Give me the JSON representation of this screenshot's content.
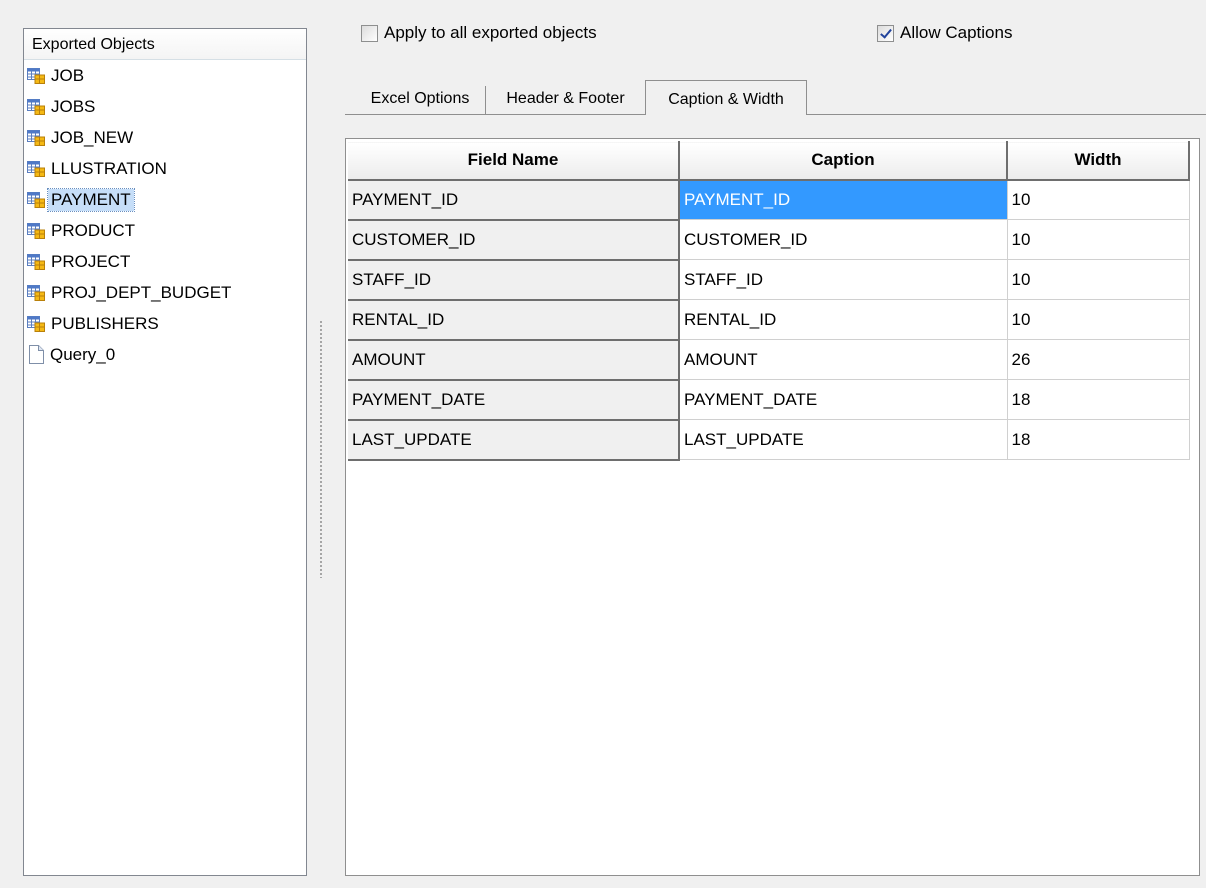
{
  "objects_panel": {
    "header": "Exported Objects",
    "items": [
      {
        "label": "JOB",
        "icon": "table-icon"
      },
      {
        "label": "JOBS",
        "icon": "table-icon"
      },
      {
        "label": "JOB_NEW",
        "icon": "table-icon"
      },
      {
        "label": "LLUSTRATION",
        "icon": "table-icon"
      },
      {
        "label": "PAYMENT",
        "icon": "table-icon",
        "selected": true
      },
      {
        "label": "PRODUCT",
        "icon": "table-icon"
      },
      {
        "label": "PROJECT",
        "icon": "table-icon"
      },
      {
        "label": "PROJ_DEPT_BUDGET",
        "icon": "table-icon"
      },
      {
        "label": "PUBLISHERS",
        "icon": "table-icon"
      },
      {
        "label": "Query_0",
        "icon": "query-icon"
      }
    ]
  },
  "options": {
    "apply_all_label": "Apply to all exported objects",
    "apply_all_checked": false,
    "allow_captions_label": "Allow Captions",
    "allow_captions_checked": true
  },
  "tabs": [
    {
      "label": "Excel Options",
      "active": false
    },
    {
      "label": "Header & Footer",
      "active": false
    },
    {
      "label": "Caption & Width",
      "active": true
    }
  ],
  "grid": {
    "columns": [
      "Field Name",
      "Caption",
      "Width"
    ],
    "rows": [
      {
        "field": "PAYMENT_ID",
        "caption": "PAYMENT_ID",
        "width": "10",
        "active": true
      },
      {
        "field": "CUSTOMER_ID",
        "caption": "CUSTOMER_ID",
        "width": "10"
      },
      {
        "field": "STAFF_ID",
        "caption": "STAFF_ID",
        "width": "10"
      },
      {
        "field": "RENTAL_ID",
        "caption": "RENTAL_ID",
        "width": "10"
      },
      {
        "field": "AMOUNT",
        "caption": "AMOUNT",
        "width": "26"
      },
      {
        "field": "PAYMENT_DATE",
        "caption": "PAYMENT_DATE",
        "width": "18"
      },
      {
        "field": "LAST_UPDATE",
        "caption": "LAST_UPDATE",
        "width": "18"
      }
    ]
  },
  "colors": {
    "selection_bg": "#3399ff",
    "list_selection_bg": "#c6def8",
    "window_bg": "#f0f0f0"
  }
}
